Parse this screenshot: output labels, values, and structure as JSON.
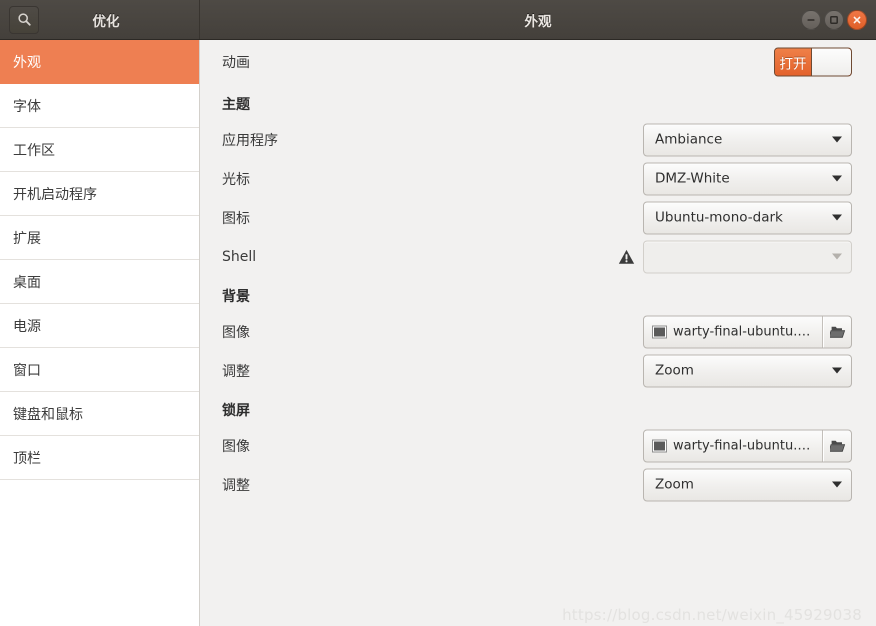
{
  "window": {
    "app_title": "优化",
    "page_title": "外观",
    "search_icon": "search-icon",
    "controls": {
      "minimize": "minimize-button",
      "maximize": "maximize-button",
      "close": "close-button"
    }
  },
  "sidebar": {
    "items": [
      {
        "label": "外观",
        "selected": true
      },
      {
        "label": "字体",
        "selected": false
      },
      {
        "label": "工作区",
        "selected": false
      },
      {
        "label": "开机启动程序",
        "selected": false
      },
      {
        "label": "扩展",
        "selected": false
      },
      {
        "label": "桌面",
        "selected": false
      },
      {
        "label": "电源",
        "selected": false
      },
      {
        "label": "窗口",
        "selected": false
      },
      {
        "label": "键盘和鼠标",
        "selected": false
      },
      {
        "label": "顶栏",
        "selected": false
      }
    ]
  },
  "content": {
    "animation": {
      "label": "动画",
      "switch_state": "打开"
    },
    "theme": {
      "section": "主题",
      "rows": [
        {
          "label": "应用程序",
          "value": "Ambiance",
          "disabled": false,
          "warning": false
        },
        {
          "label": "光标",
          "value": "DMZ-White",
          "disabled": false,
          "warning": false
        },
        {
          "label": "图标",
          "value": "Ubuntu-mono-dark",
          "disabled": false,
          "warning": false
        },
        {
          "label": "Shell",
          "value": "",
          "disabled": true,
          "warning": true
        }
      ]
    },
    "background": {
      "section": "背景",
      "image_label": "图像",
      "image_value": "warty-final-ubuntu.png",
      "adjust_label": "调整",
      "adjust_value": "Zoom"
    },
    "lockscreen": {
      "section": "锁屏",
      "image_label": "图像",
      "image_value": "warty-final-ubuntu.png",
      "adjust_label": "调整",
      "adjust_value": "Zoom"
    }
  },
  "watermark": "https://blog.csdn.net/weixin_45929038",
  "colors": {
    "headerbar": "#46423d",
    "accent": "#ee7f52",
    "content_bg": "#f2f1f0",
    "sidebar_bg": "#ffffff",
    "close_button": "#e3622c"
  }
}
